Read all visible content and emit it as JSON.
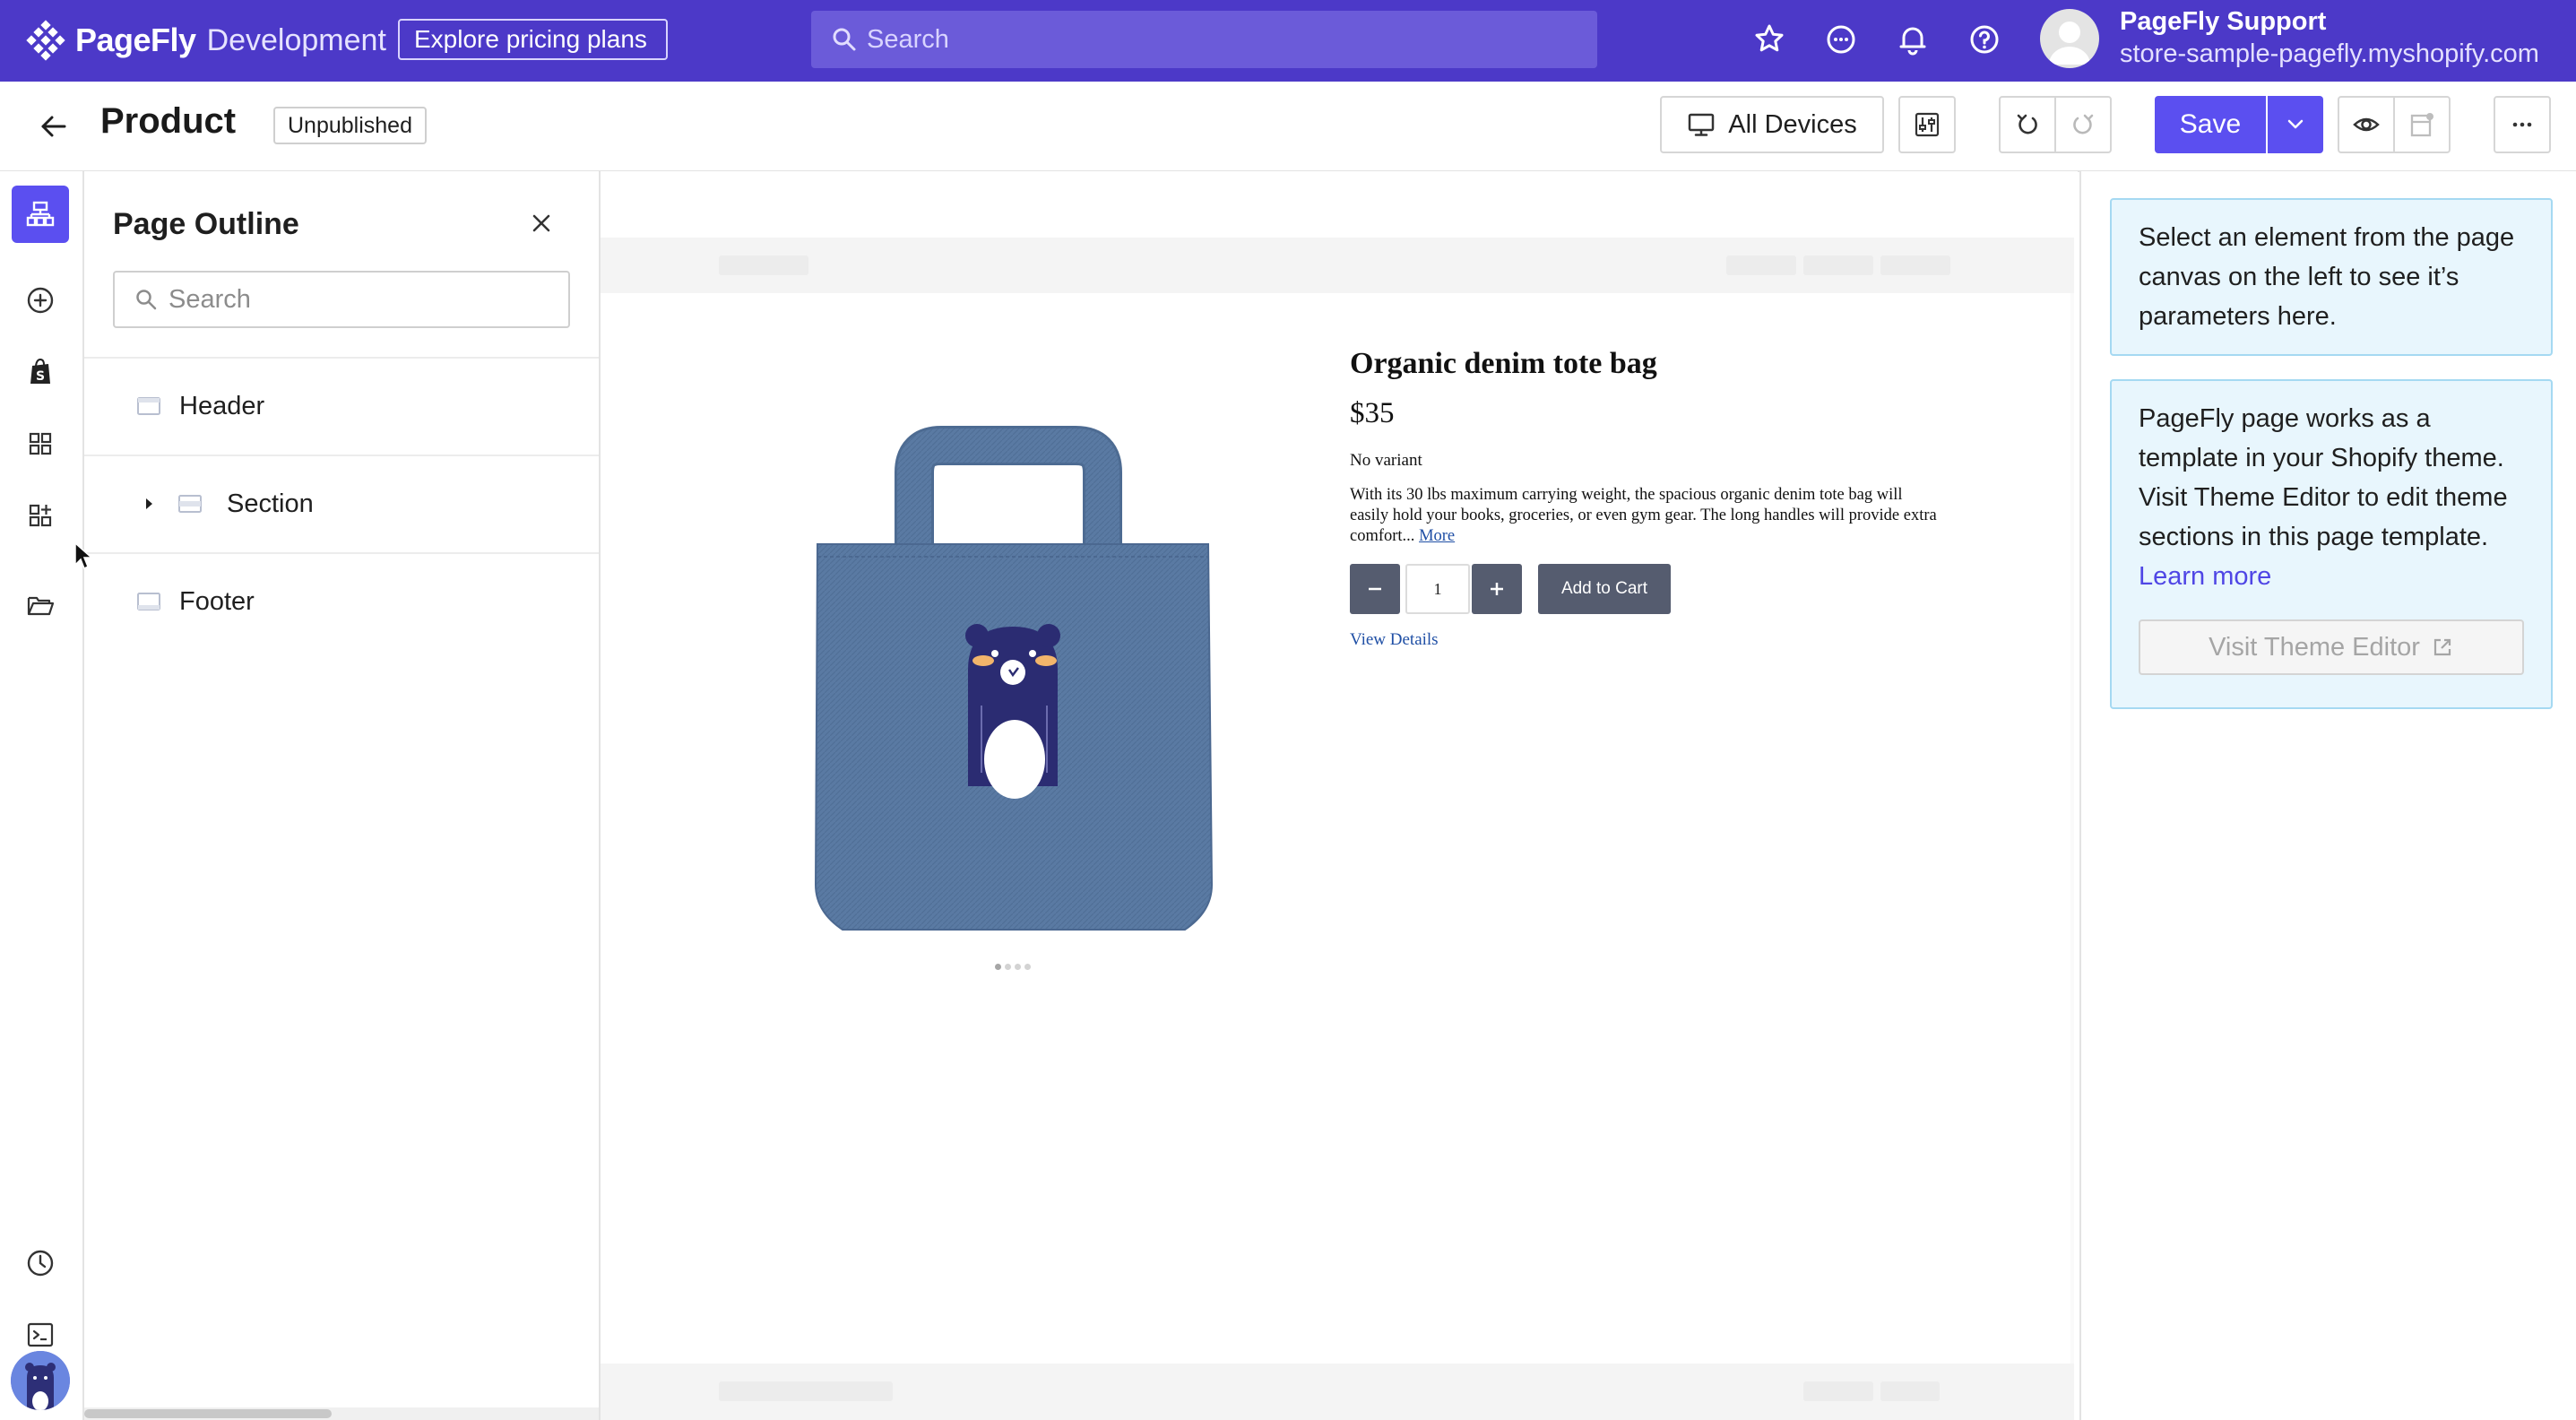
{
  "brand": {
    "name": "PageFly",
    "environment": "Development"
  },
  "topbar": {
    "pricing_label": "Explore pricing plans",
    "search_placeholder": "Search",
    "user_name": "PageFly Support",
    "user_store": "store-sample-pagefly.myshopify.com"
  },
  "header": {
    "title": "Product",
    "status": "Unpublished",
    "devices_label": "All Devices",
    "save_label": "Save"
  },
  "outline": {
    "title": "Page Outline",
    "search_placeholder": "Search",
    "items": [
      {
        "label": "Header",
        "expandable": false
      },
      {
        "label": "Section",
        "expandable": true
      },
      {
        "label": "Footer",
        "expandable": false
      }
    ]
  },
  "product": {
    "title": "Organic denim tote bag",
    "price": "$35",
    "variant": "No variant",
    "description": "With its 30 lbs maximum carrying weight, the spacious organic denim tote bag will easily hold your books, groceries, or even gym gear. The long handles will provide extra comfort...",
    "more_label": "More",
    "quantity": "1",
    "add_to_cart_label": "Add to Cart",
    "view_details_label": "View Details"
  },
  "right_panel": {
    "select_hint": "Select an element from the page canvas on the left to see it’s parameters here.",
    "theme_info": "PageFly page works as a template in your Shopify theme. Visit Theme Editor to edit theme sections in this page template.",
    "learn_more_label": "Learn more",
    "theme_editor_label": "Visit Theme Editor"
  },
  "colors": {
    "topbar": "#4c39c8",
    "accent": "#5b4ff0",
    "info_bg": "#e8f6fd",
    "info_border": "#a5d9f2",
    "product_button": "#555c6f"
  }
}
